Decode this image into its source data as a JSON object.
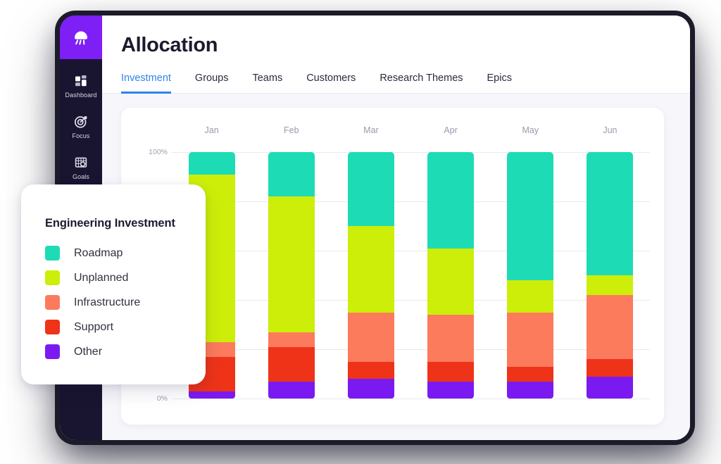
{
  "window": {
    "title": "Allocation"
  },
  "sidebar": {
    "brand_icon": "jellyfish-logo-icon",
    "items": [
      {
        "label": "Dashboard",
        "icon": "dashboard-grid-icon"
      },
      {
        "label": "Focus",
        "icon": "target-focus-icon"
      },
      {
        "label": "Goals",
        "icon": "goals-net-icon"
      }
    ]
  },
  "tabs": [
    {
      "label": "Investment",
      "active": true
    },
    {
      "label": "Groups",
      "active": false
    },
    {
      "label": "Teams",
      "active": false
    },
    {
      "label": "Customers",
      "active": false
    },
    {
      "label": "Research Themes",
      "active": false
    },
    {
      "label": "Epics",
      "active": false
    }
  ],
  "legend": {
    "title": "Engineering Investment",
    "entries": [
      {
        "label": "Roadmap",
        "color": "#1DDCB5"
      },
      {
        "label": "Unplanned",
        "color": "#CDEE09"
      },
      {
        "label": "Infrastructure",
        "color": "#FC7B5C"
      },
      {
        "label": "Support",
        "color": "#EE3319"
      },
      {
        "label": "Other",
        "color": "#7B1AF0"
      }
    ]
  },
  "chart_data": {
    "type": "bar",
    "stacked": true,
    "stack_mode": "percent",
    "title": "Engineering Investment",
    "xlabel": "",
    "ylabel": "",
    "ylim": [
      0,
      100
    ],
    "ytick_labels": [
      "0%",
      "100%"
    ],
    "ytick_values": [
      0,
      100
    ],
    "gridlines": [
      0,
      20,
      40,
      60,
      80,
      100
    ],
    "grid": true,
    "legend_position": "floating-left-card",
    "categories": [
      "Jan",
      "Feb",
      "Mar",
      "Apr",
      "May",
      "Jun"
    ],
    "series": [
      {
        "name": "Roadmap",
        "color": "#1DDCB5",
        "values": [
          9,
          18,
          30,
          39,
          52,
          50
        ]
      },
      {
        "name": "Unplanned",
        "color": "#CDEE09",
        "values": [
          68,
          55,
          35,
          27,
          13,
          8
        ]
      },
      {
        "name": "Infrastructure",
        "color": "#FC7B5C",
        "values": [
          6,
          6,
          20,
          19,
          22,
          26
        ]
      },
      {
        "name": "Support",
        "color": "#EE3319",
        "values": [
          14,
          14,
          7,
          8,
          6,
          7
        ]
      },
      {
        "name": "Other",
        "color": "#7B1AF0",
        "values": [
          3,
          7,
          8,
          7,
          7,
          9
        ]
      }
    ]
  }
}
